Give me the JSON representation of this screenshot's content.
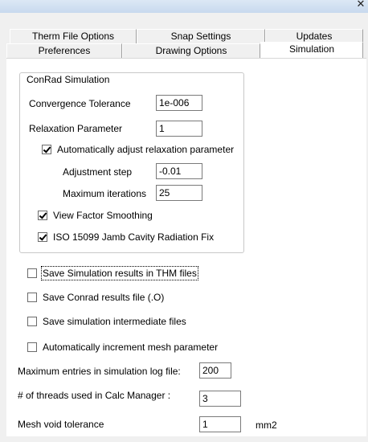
{
  "titlebar": {
    "close_glyph": "✕"
  },
  "tabs_back": [
    {
      "label": "Therm File Options"
    },
    {
      "label": "Snap Settings"
    },
    {
      "label": "Updates"
    }
  ],
  "tabs_front": [
    {
      "label": "Preferences"
    },
    {
      "label": "Drawing Options"
    },
    {
      "label": "Simulation",
      "active": true
    }
  ],
  "conrad": {
    "group_title": "ConRad Simulation",
    "convergence_label": "Convergence Tolerance",
    "convergence_value": "1e-006",
    "relaxation_label": "Relaxation Parameter",
    "relaxation_value": "1",
    "auto_adjust_label": "Automatically adjust relaxation parameter",
    "auto_adjust_checked": true,
    "adjust_step_label": "Adjustment step",
    "adjust_step_value": "-0.01",
    "max_iter_label": "Maximum iterations",
    "max_iter_value": "25",
    "view_factor_label": "View Factor Smoothing",
    "view_factor_checked": true,
    "iso_label": "ISO 15099 Jamb Cavity Radiation Fix",
    "iso_checked": true
  },
  "options": {
    "save_thm_label": "Save Simulation results in THM files",
    "save_thm_checked": false,
    "save_conrad_label": "Save Conrad results file (.O)",
    "save_conrad_checked": false,
    "save_intermediate_label": "Save simulation intermediate files",
    "save_intermediate_checked": false,
    "auto_mesh_label": "Automatically increment mesh parameter",
    "auto_mesh_checked": false,
    "max_log_label": "Maximum entries in simulation log file:",
    "max_log_value": "200",
    "threads_label": "# of threads used in Calc Manager :",
    "threads_value": "3",
    "mesh_void_label": "Mesh void tolerance",
    "mesh_void_value": "1",
    "mesh_void_unit": "mm2"
  }
}
